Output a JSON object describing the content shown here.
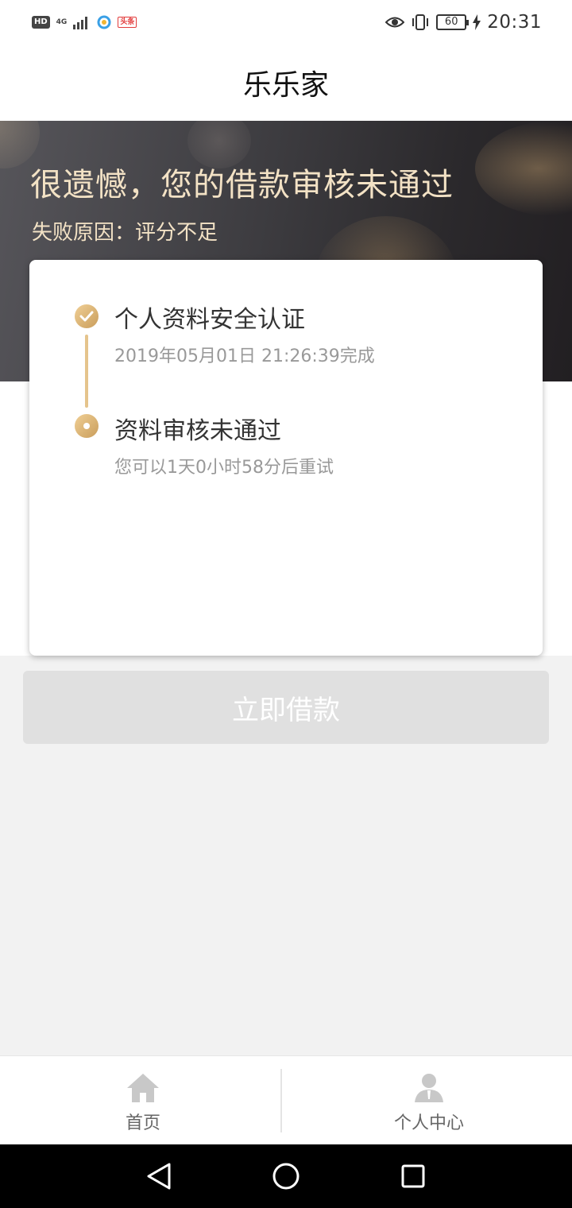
{
  "status_bar": {
    "hd": "HD",
    "network": "4G",
    "app_badge": "头条",
    "battery": "60",
    "time": "20:31"
  },
  "header": {
    "title": "乐乐家"
  },
  "banner": {
    "title": "很遗憾，您的借款审核未通过",
    "reason": "失败原因：评分不足"
  },
  "steps": [
    {
      "title": "个人资料安全认证",
      "detail": "2019年05月01日 21:26:39完成",
      "state": "done"
    },
    {
      "title": "资料审核未通过",
      "detail": "您可以1天0小时58分后重试",
      "state": "current"
    }
  ],
  "borrow_button": {
    "label": "立即借款",
    "enabled": false
  },
  "tabs": [
    {
      "label": "首页",
      "icon": "home-icon"
    },
    {
      "label": "个人中心",
      "icon": "person-icon"
    }
  ],
  "colors": {
    "accent_gold": "#e5c48c",
    "banner_text": "#f3e2c5",
    "disabled_button": "#e0e0e0"
  }
}
